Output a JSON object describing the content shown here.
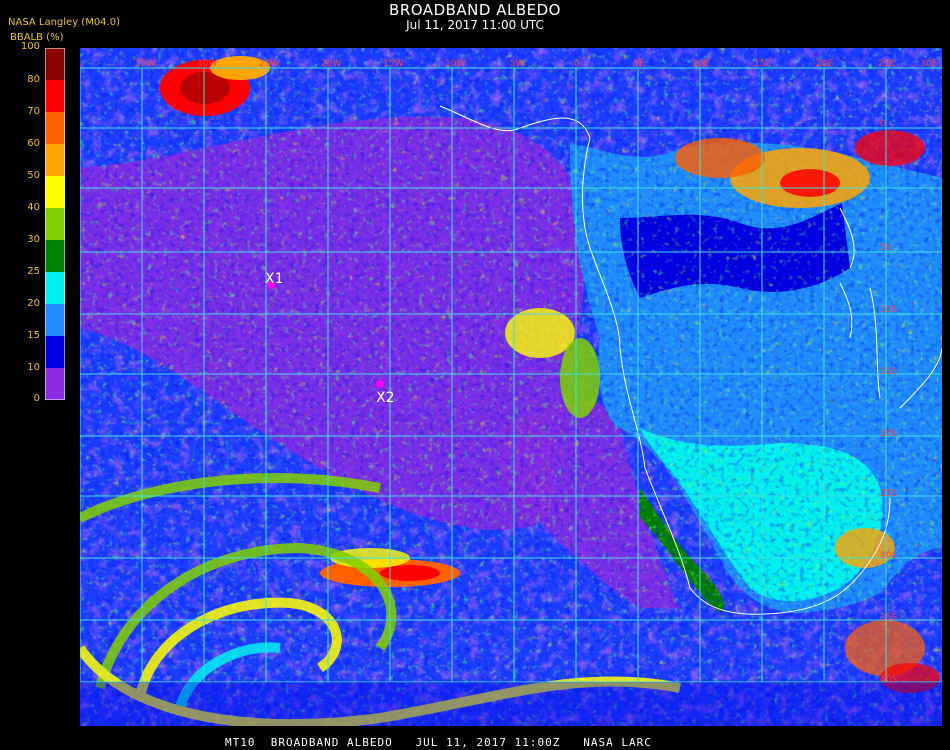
{
  "header": {
    "title": "BROADBAND ALBEDO",
    "datetime": "Jul 11, 2017 11:00 UTC",
    "producer": "NASA Langley (M04.0)"
  },
  "legend": {
    "title": "BBALB (%)",
    "ticks": [
      "100",
      "80",
      "70",
      "60",
      "50",
      "40",
      "30",
      "25",
      "20",
      "15",
      "10",
      "0"
    ],
    "bands": [
      {
        "min": 0,
        "max": 10,
        "color": "#8a2be2"
      },
      {
        "min": 10,
        "max": 15,
        "color": "#0000e0"
      },
      {
        "min": 15,
        "max": 20,
        "color": "#1e8cff"
      },
      {
        "min": 20,
        "max": 25,
        "color": "#00f0f0"
      },
      {
        "min": 25,
        "max": 30,
        "color": "#008000"
      },
      {
        "min": 30,
        "max": 40,
        "color": "#7fd000"
      },
      {
        "min": 40,
        "max": 50,
        "color": "#ffff00"
      },
      {
        "min": 50,
        "max": 60,
        "color": "#ffa500"
      },
      {
        "min": 60,
        "max": 70,
        "color": "#ff6000"
      },
      {
        "min": 70,
        "max": 80,
        "color": "#ff0000"
      },
      {
        "min": 80,
        "max": 100,
        "color": "#8b0000"
      }
    ]
  },
  "markers": [
    {
      "label": "X1"
    },
    {
      "label": "X2"
    }
  ],
  "grid": {
    "lon_labels": [
      "35W",
      "30W",
      "25W",
      "20W",
      "15W",
      "10W",
      "5W",
      "0",
      "5E",
      "10E",
      "15E",
      "20E",
      "25E",
      "30E"
    ],
    "lat_labels": [
      "0",
      "5S",
      "10S",
      "15S",
      "20S",
      "25S",
      "30S",
      "35S",
      "40S"
    ]
  },
  "footer": "MT10  BROADBAND ALBEDO   JUL 11, 2017 11:00Z   NASA LARC",
  "colors": {
    "grid": "#40e0e0",
    "coast": "#ffffff",
    "label": "#f0c030"
  }
}
